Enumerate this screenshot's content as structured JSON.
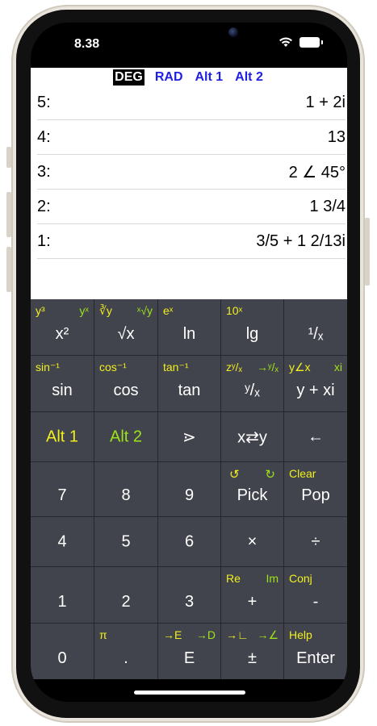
{
  "status": {
    "time": "8.38"
  },
  "modes": [
    {
      "label": "DEG",
      "active": true
    },
    {
      "label": "RAD",
      "active": false
    },
    {
      "label": "Alt 1",
      "active": false
    },
    {
      "label": "Alt 2",
      "active": false
    }
  ],
  "stack": [
    {
      "label": "5:",
      "value": "1 + 2i"
    },
    {
      "label": "4:",
      "value": "13"
    },
    {
      "label": "3:",
      "value": "2 ∠ 45°"
    },
    {
      "label": "2:",
      "value": "1 3/4"
    },
    {
      "label": "1:",
      "value": "3/5 + 1 2/13i"
    }
  ],
  "keys": {
    "r1": [
      {
        "main": "x²",
        "sub_left": "y³",
        "sub_right": "yˣ"
      },
      {
        "main": "√x",
        "sub_left": "∛y",
        "sub_right": "ˣ√y"
      },
      {
        "main": "ln",
        "sub_left": "eˣ",
        "sub_right": ""
      },
      {
        "main": "lg",
        "sub_left": "10ˣ",
        "sub_right": ""
      },
      {
        "main": "¹/ₓ",
        "sub_left": "",
        "sub_right": ""
      }
    ],
    "r2": [
      {
        "main": "sin",
        "sub_left": "sin⁻¹",
        "sub_right": ""
      },
      {
        "main": "cos",
        "sub_left": "cos⁻¹",
        "sub_right": ""
      },
      {
        "main": "tan",
        "sub_left": "tan⁻¹",
        "sub_right": ""
      },
      {
        "main": "ʸ/ₓ",
        "sub_left": "zʸ/ₓ",
        "sub_right": "→ʸ/ₓ"
      },
      {
        "main": "y + xi",
        "sub_left": "y∠x",
        "sub_right": "xi"
      }
    ],
    "r3": [
      {
        "main": "Alt 1"
      },
      {
        "main": "Alt 2"
      },
      {
        "main": "⋗"
      },
      {
        "main": "x⇄y"
      },
      {
        "main": "←"
      }
    ],
    "r4": [
      {
        "main": "7",
        "sub_left": "",
        "sub_right": ""
      },
      {
        "main": "8",
        "sub_left": "",
        "sub_right": ""
      },
      {
        "main": "9",
        "sub_left": "",
        "sub_right": ""
      },
      {
        "main": "Pick",
        "sub_left": "↺",
        "sub_right": "↻"
      },
      {
        "main": "Pop",
        "sub_left": "Clear",
        "sub_right": ""
      }
    ],
    "r5": [
      {
        "main": "4"
      },
      {
        "main": "5"
      },
      {
        "main": "6"
      },
      {
        "main": "×"
      },
      {
        "main": "÷"
      }
    ],
    "r6": [
      {
        "main": "1",
        "sub_left": "",
        "sub_right": ""
      },
      {
        "main": "2",
        "sub_left": "",
        "sub_right": ""
      },
      {
        "main": "3",
        "sub_left": "",
        "sub_right": ""
      },
      {
        "main": "+",
        "sub_left": "Re",
        "sub_right": "Im"
      },
      {
        "main": "-",
        "sub_left": "Conj",
        "sub_right": ""
      }
    ],
    "r7": [
      {
        "main": "0",
        "sub_left": "",
        "sub_right": ""
      },
      {
        "main": ".",
        "sub_left": "π",
        "sub_right": ""
      },
      {
        "main": "E",
        "sub_left": "→E",
        "sub_right": "→D"
      },
      {
        "main": "±",
        "sub_left": "→∟",
        "sub_right": "→∠"
      },
      {
        "main": "Enter",
        "sub_left": "Help",
        "sub_right": ""
      }
    ]
  },
  "colors": {
    "keypad_bg": "#42444d",
    "alt_yellow": "#f2ef1d",
    "alt_green": "#9ee21a",
    "mode_blue": "#1f1fe0"
  }
}
